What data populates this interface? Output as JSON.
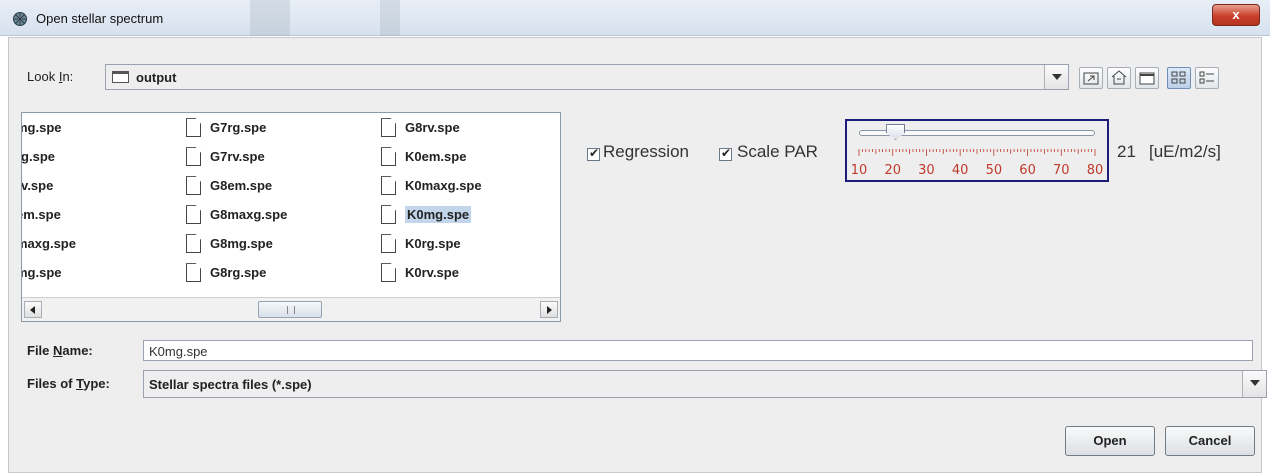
{
  "window": {
    "title": "Open stellar spectrum",
    "close_label": "x"
  },
  "look_in": {
    "label_prefix": "Look ",
    "label_mnemonic": "I",
    "label_suffix": "n:",
    "value": "output"
  },
  "toolbar": {
    "buttons": [
      "up-one-level-icon",
      "home-icon",
      "new-folder-icon",
      "list-view-icon",
      "details-view-icon"
    ]
  },
  "files": {
    "columns": [
      [
        "mg.spe",
        "rg.spe",
        "rv.spe",
        "em.spe",
        "maxg.spe",
        "mg.spe"
      ],
      [
        "G7rg.spe",
        "G7rv.spe",
        "G8em.spe",
        "G8maxg.spe",
        "G8mg.spe",
        "G8rg.spe"
      ],
      [
        "G8rv.spe",
        "K0em.spe",
        "K0maxg.spe",
        "K0mg.spe",
        "K0rg.spe",
        "K0rv.spe"
      ]
    ],
    "selected": "K0mg.spe"
  },
  "accessory": {
    "regression_label": "Regression",
    "regression_checked": true,
    "scale_par_label": "Scale PAR",
    "scale_par_checked": true,
    "slider": {
      "min": 10,
      "max": 80,
      "value": 21,
      "major_ticks": [
        "10",
        "20",
        "30",
        "40",
        "50",
        "60",
        "70",
        "80"
      ],
      "unit": "[uE/m2/s]",
      "label_color": "#c0392b"
    }
  },
  "file_name": {
    "label_prefix": "File ",
    "label_mnemonic": "N",
    "label_suffix": "ame:",
    "value": "K0mg.spe"
  },
  "file_type": {
    "label_prefix": "Files of ",
    "label_mnemonic": "T",
    "label_suffix": "ype:",
    "value": "Stellar spectra files (*.spe)"
  },
  "buttons": {
    "open": "Open",
    "cancel": "Cancel"
  }
}
